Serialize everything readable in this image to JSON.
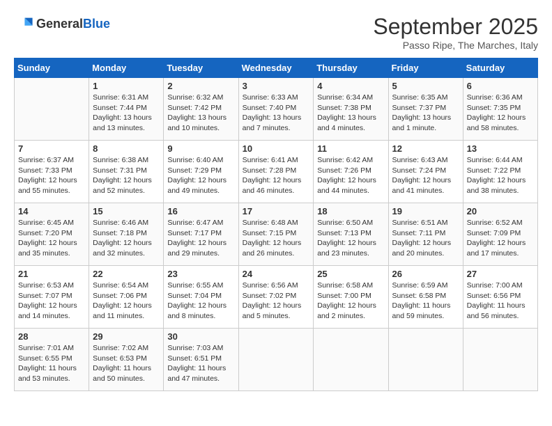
{
  "header": {
    "logo_general": "General",
    "logo_blue": "Blue",
    "month": "September 2025",
    "location": "Passo Ripe, The Marches, Italy"
  },
  "weekdays": [
    "Sunday",
    "Monday",
    "Tuesday",
    "Wednesday",
    "Thursday",
    "Friday",
    "Saturday"
  ],
  "weeks": [
    [
      {
        "day": "",
        "detail": ""
      },
      {
        "day": "1",
        "detail": "Sunrise: 6:31 AM\nSunset: 7:44 PM\nDaylight: 13 hours\nand 13 minutes."
      },
      {
        "day": "2",
        "detail": "Sunrise: 6:32 AM\nSunset: 7:42 PM\nDaylight: 13 hours\nand 10 minutes."
      },
      {
        "day": "3",
        "detail": "Sunrise: 6:33 AM\nSunset: 7:40 PM\nDaylight: 13 hours\nand 7 minutes."
      },
      {
        "day": "4",
        "detail": "Sunrise: 6:34 AM\nSunset: 7:38 PM\nDaylight: 13 hours\nand 4 minutes."
      },
      {
        "day": "5",
        "detail": "Sunrise: 6:35 AM\nSunset: 7:37 PM\nDaylight: 13 hours\nand 1 minute."
      },
      {
        "day": "6",
        "detail": "Sunrise: 6:36 AM\nSunset: 7:35 PM\nDaylight: 12 hours\nand 58 minutes."
      }
    ],
    [
      {
        "day": "7",
        "detail": "Sunrise: 6:37 AM\nSunset: 7:33 PM\nDaylight: 12 hours\nand 55 minutes."
      },
      {
        "day": "8",
        "detail": "Sunrise: 6:38 AM\nSunset: 7:31 PM\nDaylight: 12 hours\nand 52 minutes."
      },
      {
        "day": "9",
        "detail": "Sunrise: 6:40 AM\nSunset: 7:29 PM\nDaylight: 12 hours\nand 49 minutes."
      },
      {
        "day": "10",
        "detail": "Sunrise: 6:41 AM\nSunset: 7:28 PM\nDaylight: 12 hours\nand 46 minutes."
      },
      {
        "day": "11",
        "detail": "Sunrise: 6:42 AM\nSunset: 7:26 PM\nDaylight: 12 hours\nand 44 minutes."
      },
      {
        "day": "12",
        "detail": "Sunrise: 6:43 AM\nSunset: 7:24 PM\nDaylight: 12 hours\nand 41 minutes."
      },
      {
        "day": "13",
        "detail": "Sunrise: 6:44 AM\nSunset: 7:22 PM\nDaylight: 12 hours\nand 38 minutes."
      }
    ],
    [
      {
        "day": "14",
        "detail": "Sunrise: 6:45 AM\nSunset: 7:20 PM\nDaylight: 12 hours\nand 35 minutes."
      },
      {
        "day": "15",
        "detail": "Sunrise: 6:46 AM\nSunset: 7:18 PM\nDaylight: 12 hours\nand 32 minutes."
      },
      {
        "day": "16",
        "detail": "Sunrise: 6:47 AM\nSunset: 7:17 PM\nDaylight: 12 hours\nand 29 minutes."
      },
      {
        "day": "17",
        "detail": "Sunrise: 6:48 AM\nSunset: 7:15 PM\nDaylight: 12 hours\nand 26 minutes."
      },
      {
        "day": "18",
        "detail": "Sunrise: 6:50 AM\nSunset: 7:13 PM\nDaylight: 12 hours\nand 23 minutes."
      },
      {
        "day": "19",
        "detail": "Sunrise: 6:51 AM\nSunset: 7:11 PM\nDaylight: 12 hours\nand 20 minutes."
      },
      {
        "day": "20",
        "detail": "Sunrise: 6:52 AM\nSunset: 7:09 PM\nDaylight: 12 hours\nand 17 minutes."
      }
    ],
    [
      {
        "day": "21",
        "detail": "Sunrise: 6:53 AM\nSunset: 7:07 PM\nDaylight: 12 hours\nand 14 minutes."
      },
      {
        "day": "22",
        "detail": "Sunrise: 6:54 AM\nSunset: 7:06 PM\nDaylight: 12 hours\nand 11 minutes."
      },
      {
        "day": "23",
        "detail": "Sunrise: 6:55 AM\nSunset: 7:04 PM\nDaylight: 12 hours\nand 8 minutes."
      },
      {
        "day": "24",
        "detail": "Sunrise: 6:56 AM\nSunset: 7:02 PM\nDaylight: 12 hours\nand 5 minutes."
      },
      {
        "day": "25",
        "detail": "Sunrise: 6:58 AM\nSunset: 7:00 PM\nDaylight: 12 hours\nand 2 minutes."
      },
      {
        "day": "26",
        "detail": "Sunrise: 6:59 AM\nSunset: 6:58 PM\nDaylight: 11 hours\nand 59 minutes."
      },
      {
        "day": "27",
        "detail": "Sunrise: 7:00 AM\nSunset: 6:56 PM\nDaylight: 11 hours\nand 56 minutes."
      }
    ],
    [
      {
        "day": "28",
        "detail": "Sunrise: 7:01 AM\nSunset: 6:55 PM\nDaylight: 11 hours\nand 53 minutes."
      },
      {
        "day": "29",
        "detail": "Sunrise: 7:02 AM\nSunset: 6:53 PM\nDaylight: 11 hours\nand 50 minutes."
      },
      {
        "day": "30",
        "detail": "Sunrise: 7:03 AM\nSunset: 6:51 PM\nDaylight: 11 hours\nand 47 minutes."
      },
      {
        "day": "",
        "detail": ""
      },
      {
        "day": "",
        "detail": ""
      },
      {
        "day": "",
        "detail": ""
      },
      {
        "day": "",
        "detail": ""
      }
    ]
  ]
}
